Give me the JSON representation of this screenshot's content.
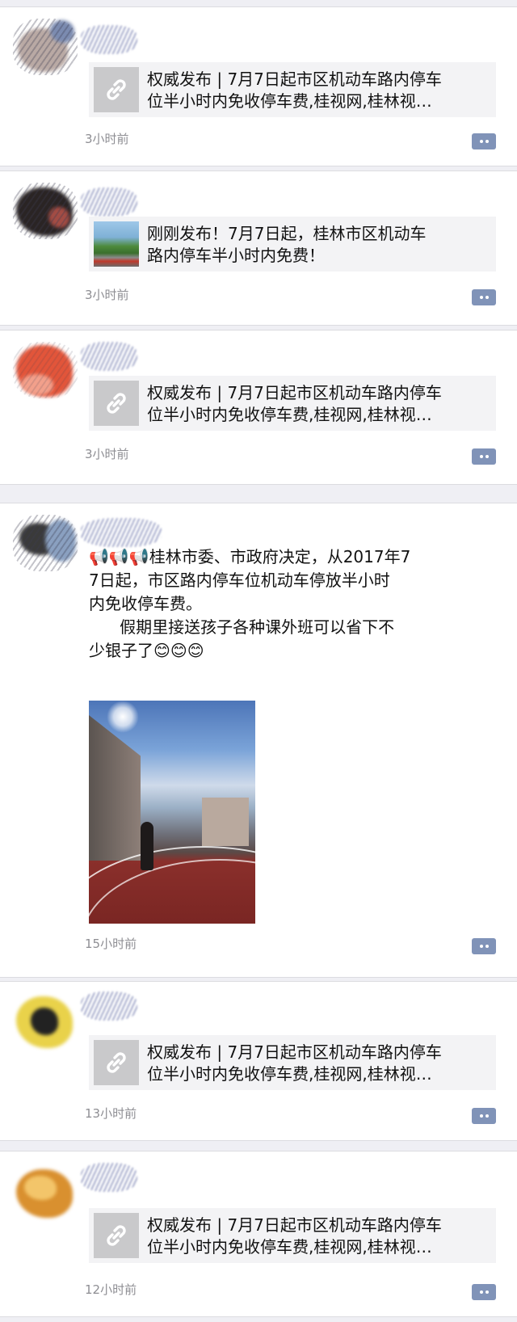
{
  "posts": [
    {
      "type": "link",
      "avatar_colors": [
        "#b9a9a4",
        "#7b8bb0"
      ],
      "share_title": "权威发布 | 7月7日起市区机动车路内停车\n位半小时内免收停车费,桂视网,桂林视…",
      "thumb_icon": "link-icon",
      "time": "3小时前"
    },
    {
      "type": "link",
      "avatar_colors": [
        "#2a2424",
        "#a34c44"
      ],
      "share_title": "刚刚发布！7月7日起，桂林市区机动车\n路内停车半小时内免费！",
      "thumb_icon": "street-photo",
      "time": "3小时前"
    },
    {
      "type": "link",
      "avatar_colors": [
        "#e2553a",
        "#f2a08b"
      ],
      "share_title": "权威发布 | 7月7日起市区机动车路内停车\n位半小时内免收停车费,桂视网,桂林视…",
      "thumb_icon": "link-icon",
      "time": "3小时前"
    },
    {
      "type": "text-photo",
      "avatar_colors": [
        "#3a3a3a",
        "#8aa0c0"
      ],
      "text": "📢📢📢桂林市委、市政府决定，从2017年7\n7日起，市区路内停车位机动车停放半小时\n内免收停车费。\n      假期里接送孩子各种课外班可以省下不\n少银子了😊😊😊",
      "time": "15小时前"
    },
    {
      "type": "link",
      "avatar_colors": [
        "#e9d24a",
        "#222222"
      ],
      "share_title": "权威发布 | 7月7日起市区机动车路内停车\n位半小时内免收停车费,桂视网,桂林视…",
      "thumb_icon": "link-icon",
      "time": "13小时前"
    },
    {
      "type": "link",
      "avatar_colors": [
        "#d9902f",
        "#f3c56a"
      ],
      "share_title": "权威发布 | 7月7日起市区机动车路内停车\n位半小时内免收停车费,桂视网,桂林视…",
      "thumb_icon": "link-icon",
      "time": "12小时前"
    }
  ],
  "icons": {
    "comment": "comment-icon"
  }
}
